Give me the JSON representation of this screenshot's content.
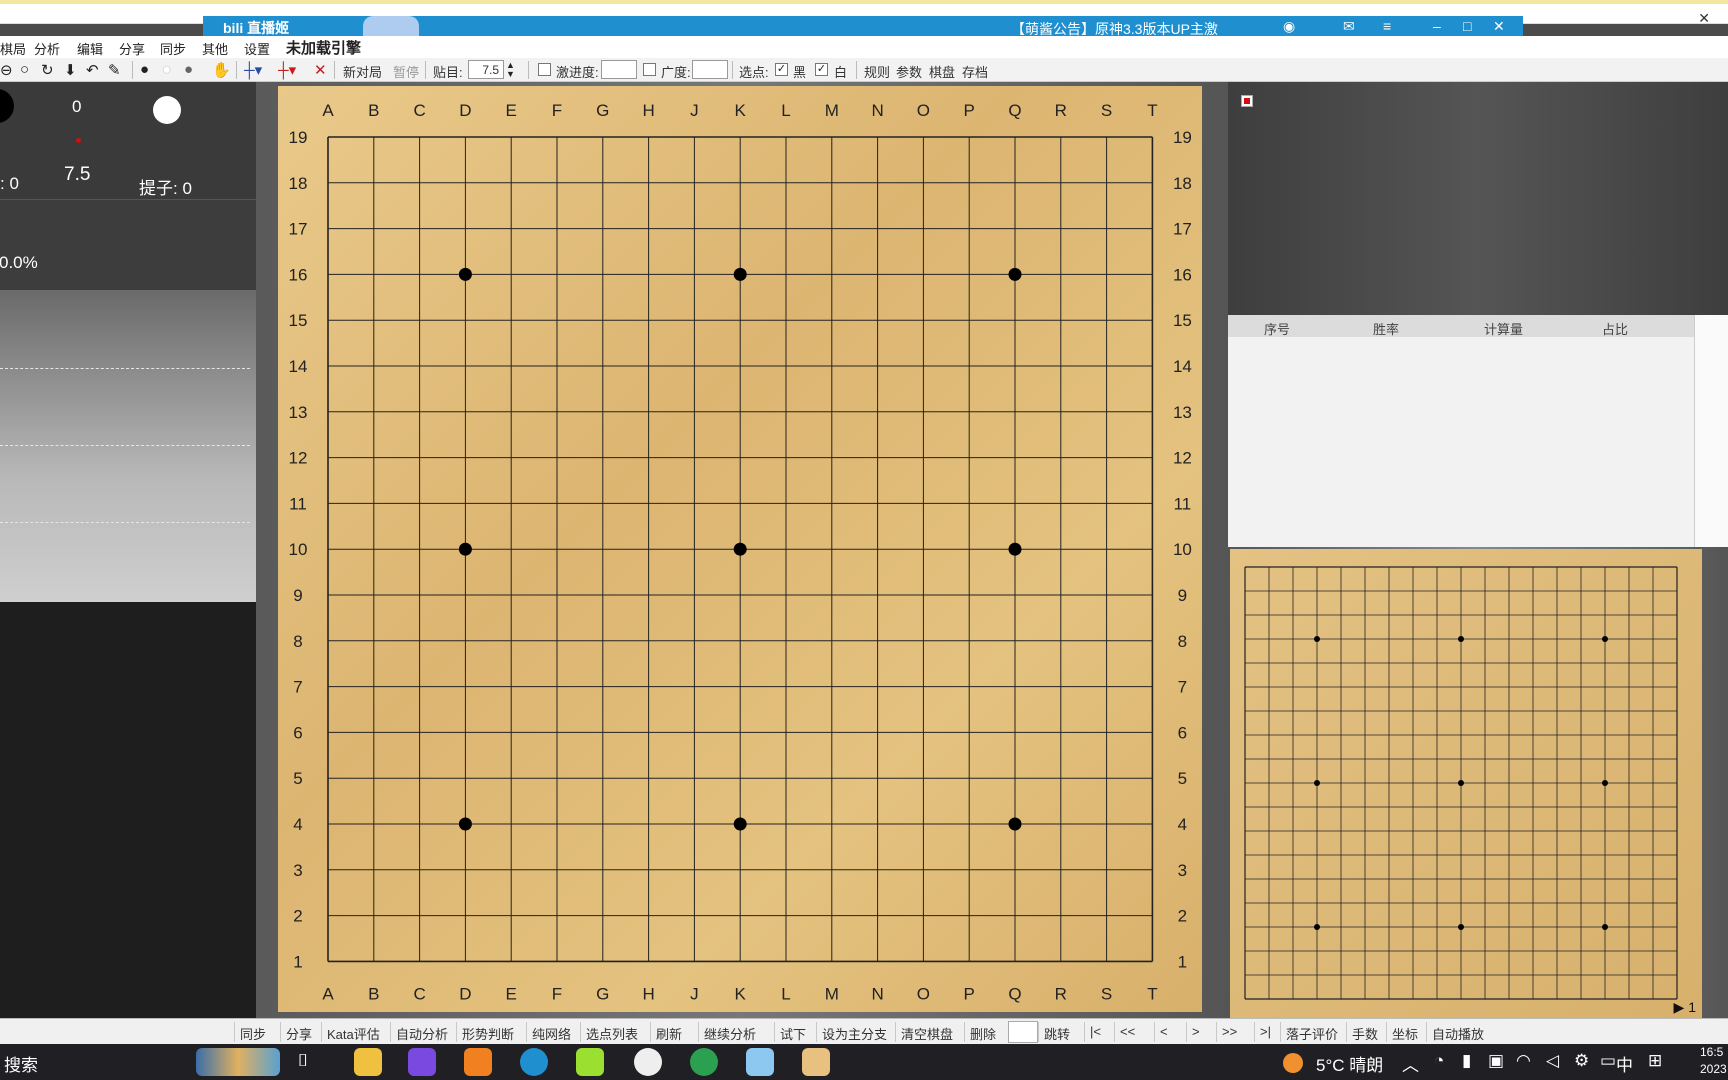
{
  "window": {
    "overlay_logo": "bili 直播姬",
    "overlay_news": "【萌酱公告】原神3.3版本UP主激",
    "close_label": "✕"
  },
  "menu": {
    "partial_top": [
      "棋局",
      "分析",
      "编辑",
      "分享",
      "同步"
    ],
    "items": [
      "棋局",
      "分析",
      "编辑",
      "分享",
      "同步",
      "其他",
      "设置"
    ],
    "engine_status": "未加载引擎"
  },
  "toolbar": {
    "new_game": "新对局",
    "pause": "暂停",
    "komi_label": "贴目:",
    "komi_value": "7.5",
    "aggressive_label": "激进度:",
    "breadth_label": "广度:",
    "select_point_label": "选点:",
    "black_label": "黑",
    "white_label": "白",
    "rules": "规则",
    "params": "参数",
    "board": "棋盘",
    "save": "存档"
  },
  "left_panel": {
    "black_captures_partial": ": 0",
    "move_number": "0",
    "komi": "7.5",
    "white_captures": "提子: 0",
    "winrate_partial": "0.0%"
  },
  "board": {
    "columns": [
      "A",
      "B",
      "C",
      "D",
      "E",
      "F",
      "G",
      "H",
      "J",
      "K",
      "L",
      "M",
      "N",
      "O",
      "P",
      "Q",
      "R",
      "S",
      "T"
    ],
    "rows": [
      "19",
      "18",
      "17",
      "16",
      "15",
      "14",
      "13",
      "12",
      "11",
      "10",
      "9",
      "8",
      "7",
      "6",
      "5",
      "4",
      "3",
      "2",
      "1"
    ],
    "star_points": [
      [
        3,
        3
      ],
      [
        9,
        3
      ],
      [
        15,
        3
      ],
      [
        3,
        9
      ],
      [
        9,
        9
      ],
      [
        15,
        9
      ],
      [
        3,
        15
      ],
      [
        9,
        15
      ],
      [
        15,
        15
      ]
    ]
  },
  "right_panel": {
    "table_headers": [
      "序号",
      "胜率",
      "计算量",
      "占比"
    ],
    "mini_play_label": "▶ 1"
  },
  "bottom_bar": {
    "buttons": [
      "同步",
      "分享",
      "Kata评估",
      "自动分析",
      "形势判断",
      "纯网络",
      "选点列表",
      "刷新",
      "继续分析",
      "试下",
      "设为主分支",
      "清空棋盘",
      "删除",
      "跳转",
      "|<",
      "<<",
      "<",
      ">",
      ">>",
      ">|",
      "落子评价",
      "手数",
      "坐标",
      "自动播放"
    ]
  },
  "taskbar": {
    "search": "搜索",
    "weather": "5°C 晴朗",
    "ime": "中",
    "time_partial": "16:5",
    "date_partial": "2023"
  }
}
